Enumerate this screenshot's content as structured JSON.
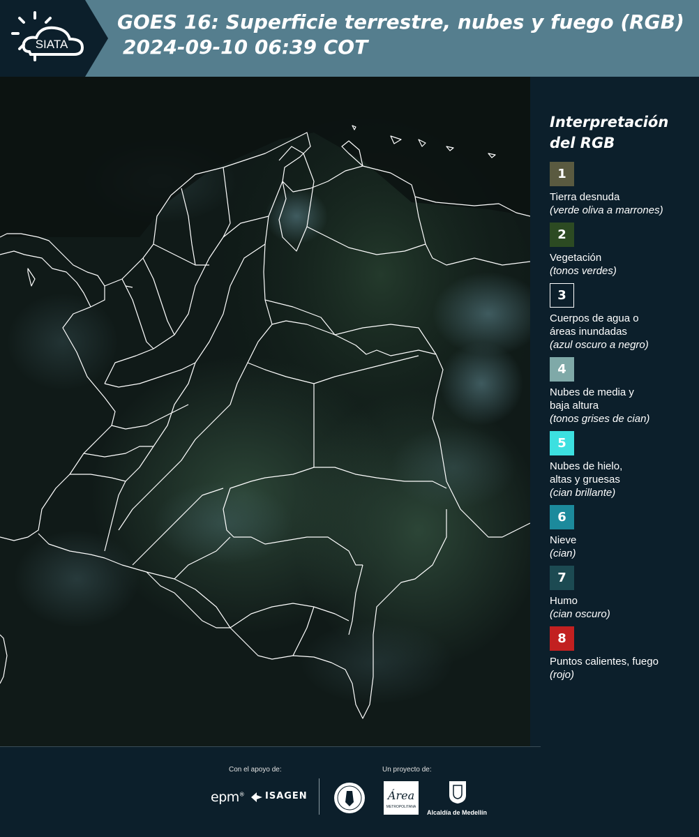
{
  "header": {
    "logo_text": "SIATA",
    "title": "GOES 16: Superficie terrestre, nubes y fuego (RGB)",
    "timestamp": "2024-09-10 06:39 COT"
  },
  "legend": {
    "title_line1": "Interpretación",
    "title_line2": "del RGB",
    "items": [
      {
        "number": "1",
        "color": "#5a5a40",
        "label": "Tierra desnuda",
        "desc": "(verde oliva a marrones)"
      },
      {
        "number": "2",
        "color": "#2c4a22",
        "label": "Vegetación",
        "desc": "(tonos verdes)"
      },
      {
        "number": "3",
        "color": "#0c1f2b",
        "label": "Cuerpos de agua o\náreas inundadas",
        "desc": "(azul oscuro a negro)"
      },
      {
        "number": "4",
        "color": "#7fa9a8",
        "label": "Nubes de media y\nbaja altura",
        "desc": "(tonos grises de cian)"
      },
      {
        "number": "5",
        "color": "#3ce0e0",
        "label": "Nubes de hielo,\naltas y gruesas",
        "desc": "(cian brillante)"
      },
      {
        "number": "6",
        "color": "#1c8a9c",
        "label": "Nieve",
        "desc": "(cian)"
      },
      {
        "number": "7",
        "color": "#1c4a52",
        "label": "Humo",
        "desc": "(cian oscuro)"
      },
      {
        "number": "8",
        "color": "#c22020",
        "label": "Puntos calientes, fuego",
        "desc": "(rojo)"
      }
    ]
  },
  "footer": {
    "support_label": "Con el apoyo de:",
    "project_label": "Un proyecto de:",
    "epm": "epm",
    "isagen": "ISAGEN",
    "area_logo_text": "Área",
    "area_logo_sub": "METROPOLITANA",
    "alcaldia": "Alcaldía de Medellín"
  }
}
